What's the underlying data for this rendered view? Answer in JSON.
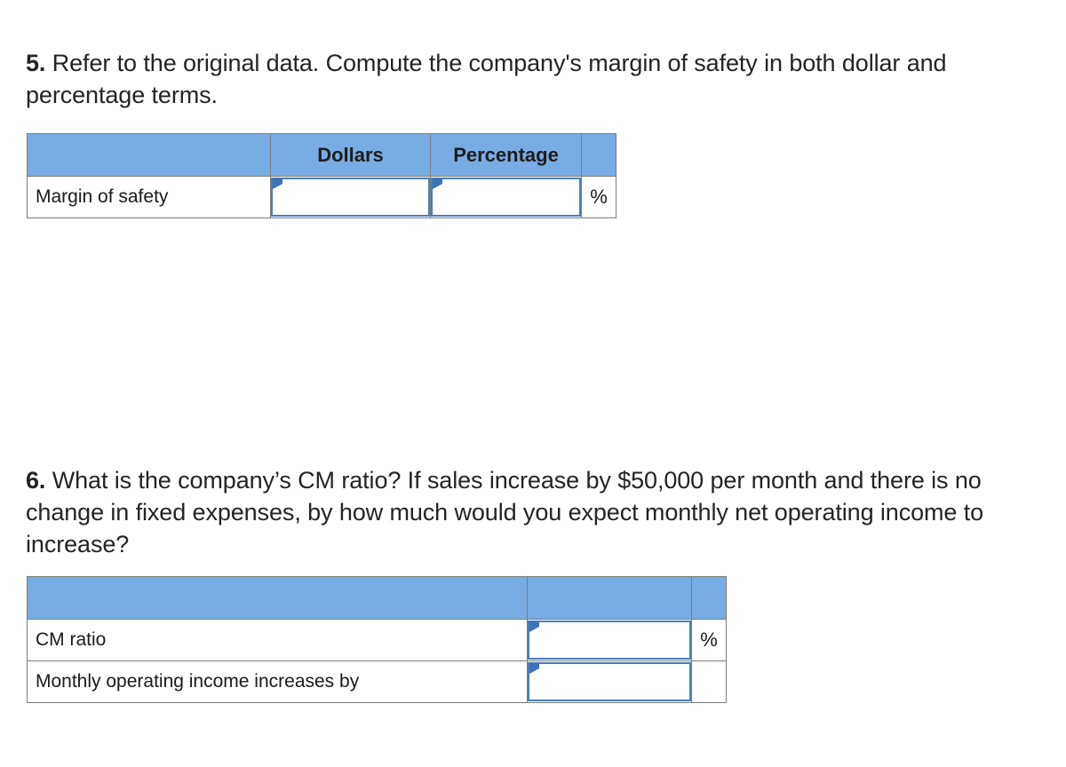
{
  "questions": [
    {
      "number": "5.",
      "text": " Refer to the original data. Compute the company's margin of safety in both dollar and percentage terms."
    },
    {
      "number": "6.",
      "text": " What is the company’s CM ratio? If sales increase by $50,000 per month and there is no change in fixed expenses, by how much would you expect monthly net operating income to increase?"
    }
  ],
  "colors": {
    "header_blue": "#78ACE4",
    "input_border_blue": "#4A7EBC",
    "marker_blue": "#3B74B8",
    "grid_gray": "#7d7d7d"
  },
  "table_margin_of_safety": {
    "headers": [
      "",
      "Dollars",
      "Percentage",
      ""
    ],
    "rows": [
      {
        "label": "Margin of safety",
        "dollars_value": "",
        "dollars_placeholder": "",
        "percentage_value": "",
        "percentage_placeholder": "",
        "unit": "%"
      }
    ]
  },
  "table_cm_ratio": {
    "headers": [
      "",
      "",
      ""
    ],
    "rows": [
      {
        "label": "CM ratio",
        "value": "",
        "placeholder": "",
        "unit": "%"
      },
      {
        "label": "Monthly operating income increases by",
        "value": "",
        "placeholder": "",
        "unit": ""
      }
    ]
  }
}
